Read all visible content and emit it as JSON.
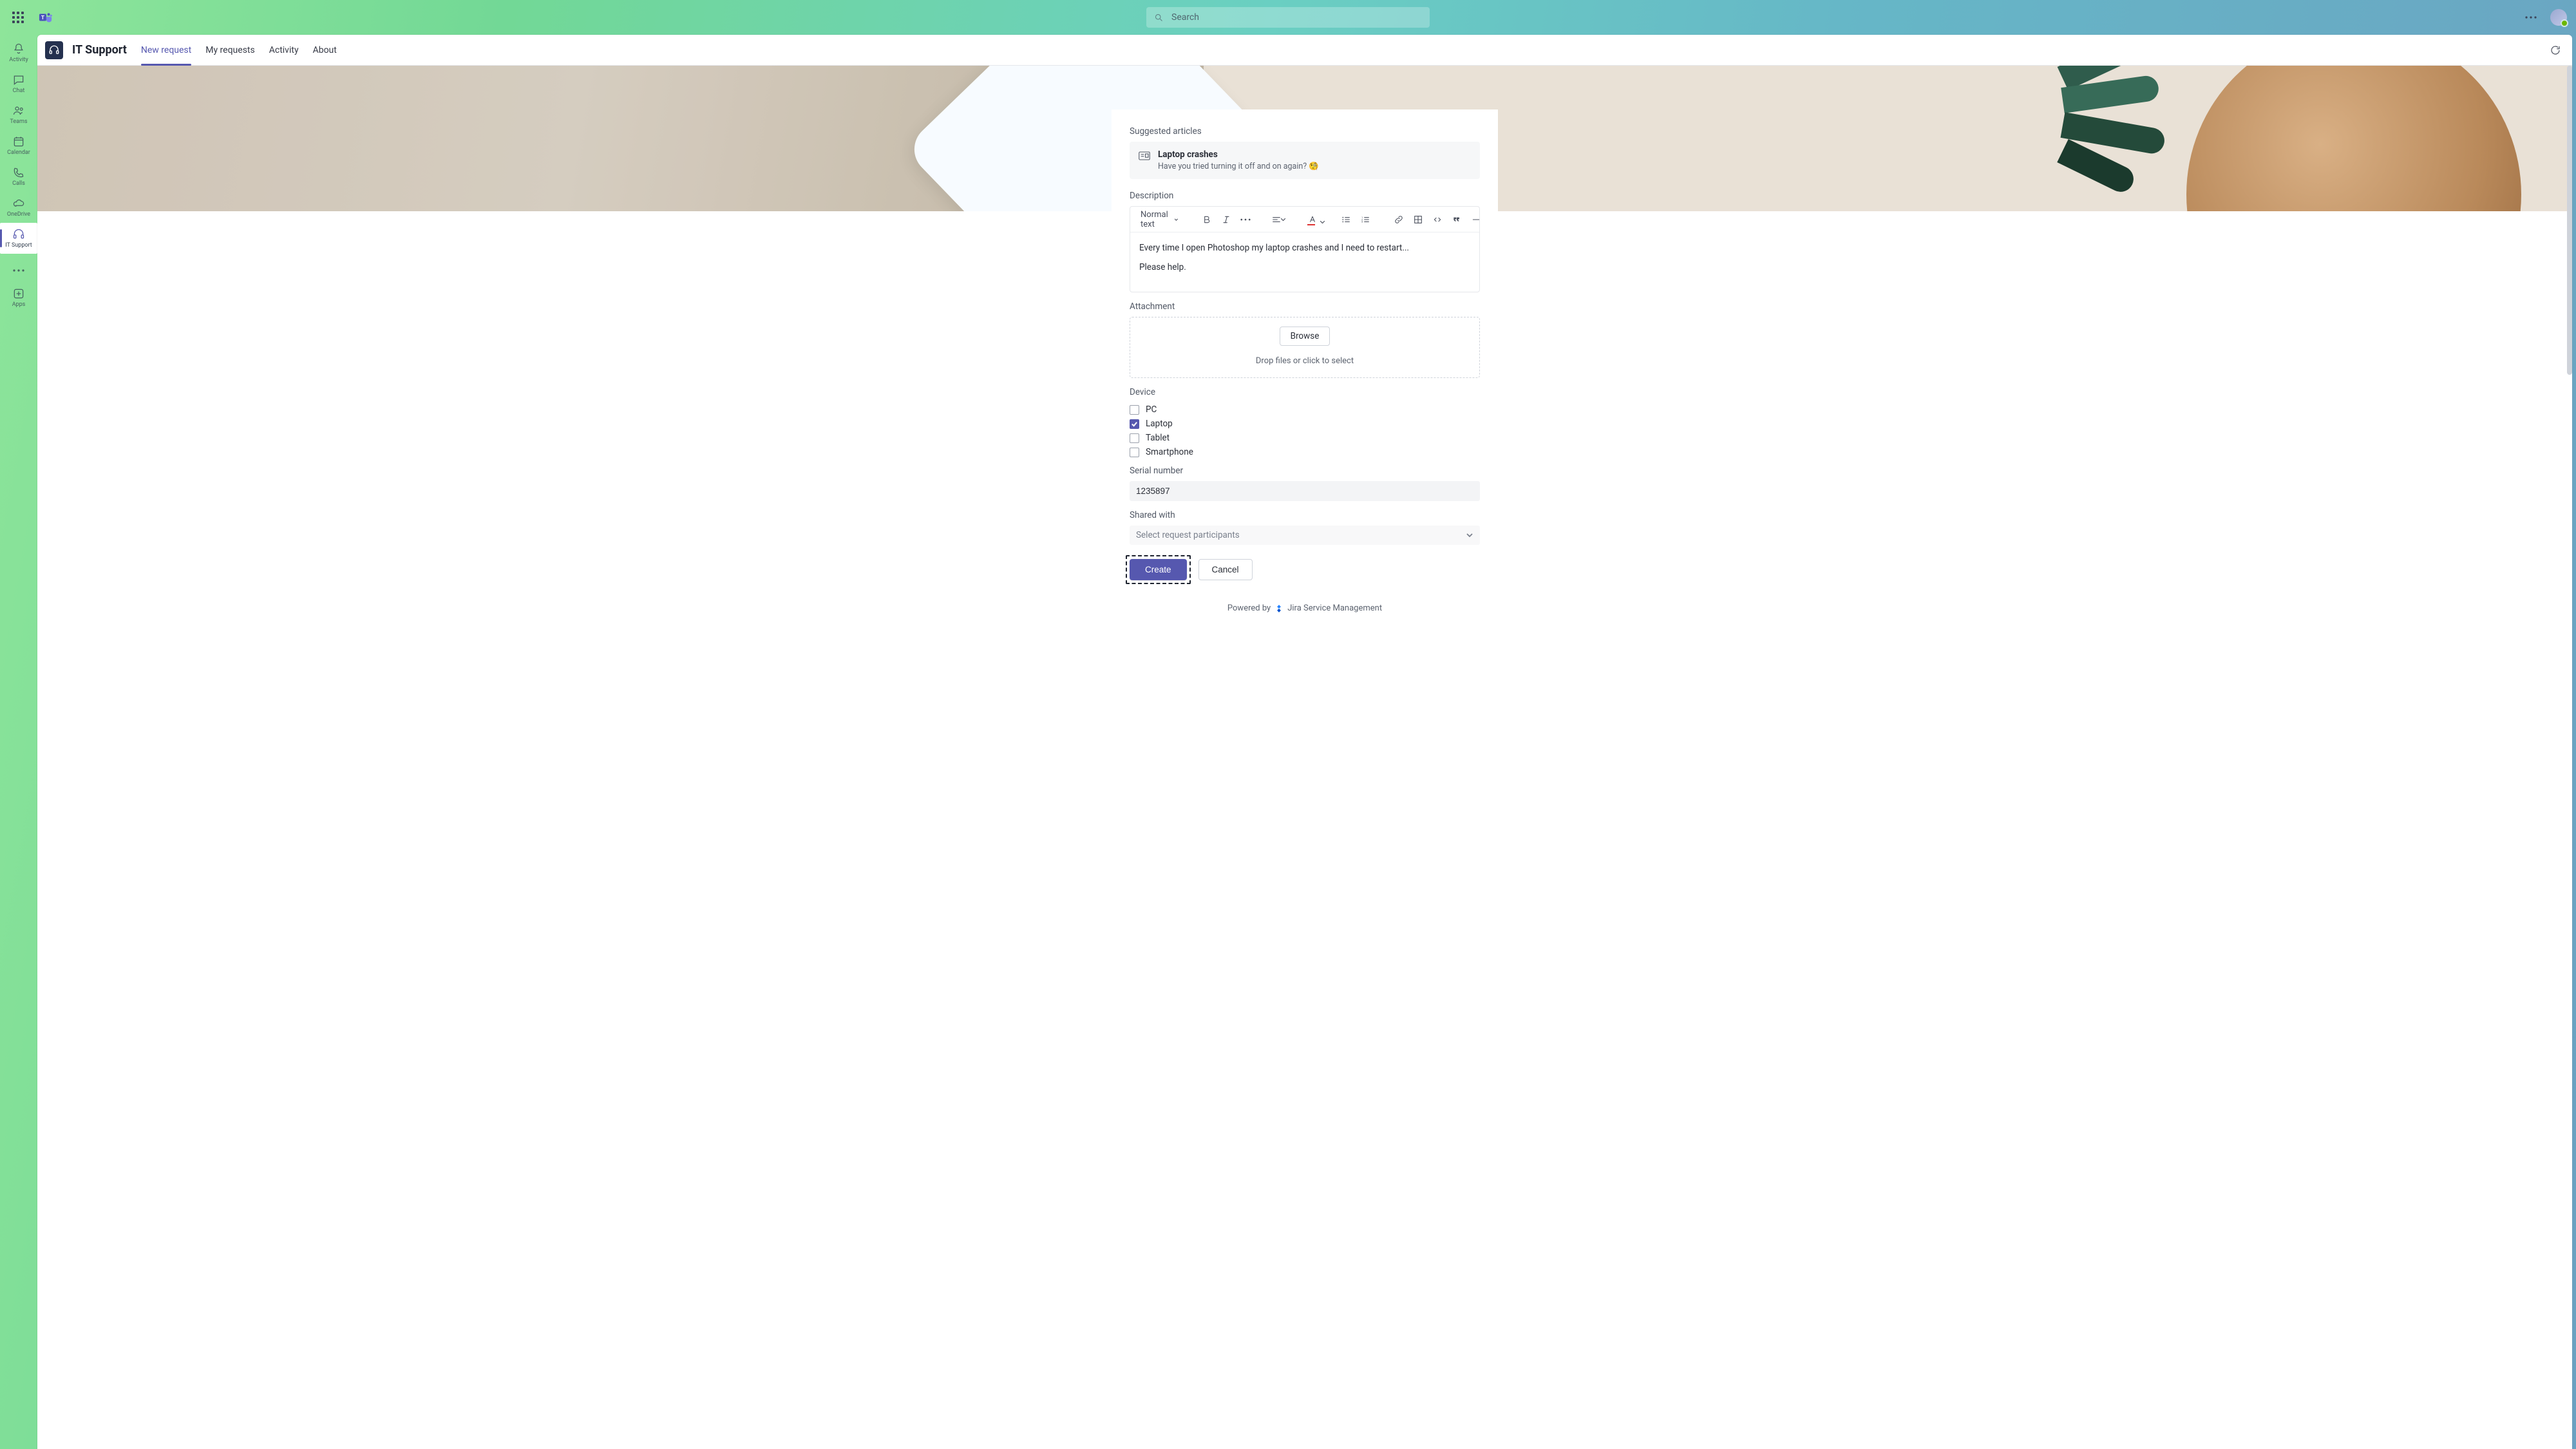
{
  "top": {
    "search_placeholder": "Search"
  },
  "rail": {
    "activity": "Activity",
    "chat": "Chat",
    "teams": "Teams",
    "calendar": "Calendar",
    "calls": "Calls",
    "onedrive": "OneDrive",
    "itsupport": "IT Support",
    "apps": "Apps"
  },
  "app": {
    "title": "IT Support",
    "tabs": {
      "new_request": "New request",
      "my_requests": "My requests",
      "activity": "Activity",
      "about": "About"
    }
  },
  "form": {
    "suggested_label": "Suggested articles",
    "suggested": {
      "title": "Laptop crashes",
      "subtitle": "Have you tried turning it off and on again? 🧐"
    },
    "description_label": "Description",
    "text_style": "Normal text",
    "description_line1": "Every time I open Photoshop my laptop crashes and I need to restart...",
    "description_line2": "Please help.",
    "attachment_label": "Attachment",
    "browse": "Browse",
    "drop_hint": "Drop files or click to select",
    "device_label": "Device",
    "devices": {
      "pc": "PC",
      "laptop": "Laptop",
      "tablet": "Tablet",
      "smartphone": "Smartphone"
    },
    "serial_label": "Serial number",
    "serial_value": "1235897",
    "shared_label": "Shared with",
    "shared_placeholder": "Select request participants",
    "create": "Create",
    "cancel": "Cancel",
    "powered_prefix": "Powered by",
    "powered_product": "Jira Service Management"
  }
}
